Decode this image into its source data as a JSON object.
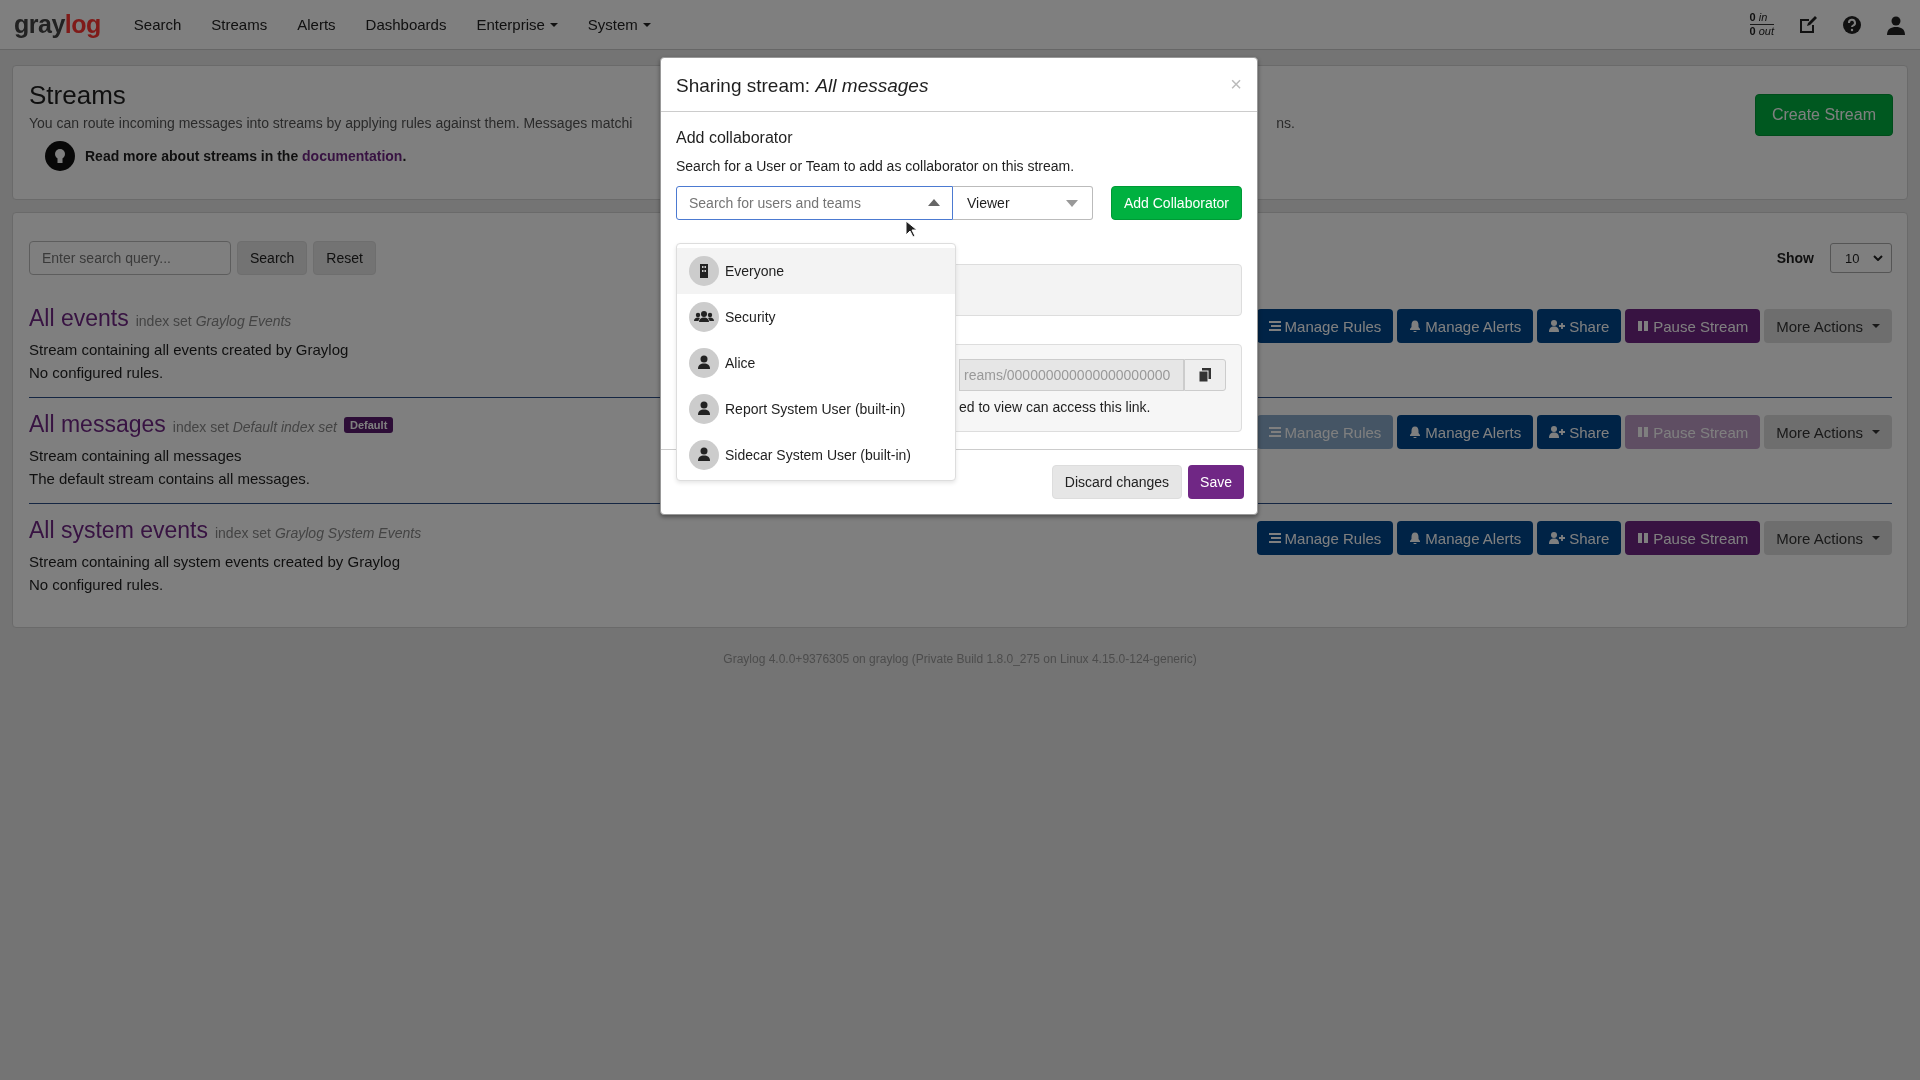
{
  "nav": {
    "logo": [
      "gray",
      "log"
    ],
    "items": [
      {
        "label": "Search",
        "dropdown": false
      },
      {
        "label": "Streams",
        "dropdown": false
      },
      {
        "label": "Alerts",
        "dropdown": false
      },
      {
        "label": "Dashboards",
        "dropdown": false
      },
      {
        "label": "Enterprise",
        "dropdown": true
      },
      {
        "label": "System",
        "dropdown": true
      }
    ],
    "throughput": [
      {
        "count": "0",
        "label": "in"
      },
      {
        "count": "0",
        "label": "out"
      }
    ]
  },
  "header": {
    "title": "Streams",
    "description": "You can route incoming messages into streams by applying rules against them. Messages matchi",
    "description_tail": "ns.",
    "tip": "Read more about streams in the ",
    "tip_link": "documentation",
    "tip_end": ".",
    "create_button": "Create Stream"
  },
  "list": {
    "search_placeholder": "Enter search query...",
    "search_button": "Search",
    "reset_button": "Reset",
    "show_label": "Show",
    "page_size": "10",
    "streams": [
      {
        "title": "All events",
        "index_label": "index set",
        "index_set": "Graylog Events",
        "lines": [
          "Stream containing all events created by Graylog",
          "No configured rules."
        ],
        "buttons": [
          {
            "kind": "rules",
            "label": "Manage Rules",
            "disabled": false
          },
          {
            "kind": "alerts",
            "label": "Manage Alerts",
            "disabled": false
          },
          {
            "kind": "share",
            "label": "Share",
            "disabled": false
          },
          {
            "kind": "pause",
            "label": "Pause Stream",
            "disabled": false
          },
          {
            "kind": "more",
            "label": "More Actions",
            "disabled": false
          }
        ]
      },
      {
        "title": "All messages",
        "index_label": "index set",
        "index_set": "Default index set",
        "badge": "Default",
        "lines": [
          "Stream containing all messages",
          "The default stream contains all messages."
        ],
        "buttons": [
          {
            "kind": "rules",
            "label": "Manage Rules",
            "disabled": true
          },
          {
            "kind": "alerts",
            "label": "Manage Alerts",
            "disabled": false
          },
          {
            "kind": "share",
            "label": "Share",
            "disabled": false
          },
          {
            "kind": "pause",
            "label": "Pause Stream",
            "disabled": true
          },
          {
            "kind": "more",
            "label": "More Actions",
            "disabled": false
          }
        ]
      },
      {
        "title": "All system events",
        "index_label": "index set",
        "index_set": "Graylog System Events",
        "lines": [
          "Stream containing all system events created by Graylog",
          "No configured rules."
        ],
        "buttons": [
          {
            "kind": "rules",
            "label": "Manage Rules",
            "disabled": false
          },
          {
            "kind": "alerts",
            "label": "Manage Alerts",
            "disabled": false
          },
          {
            "kind": "share",
            "label": "Share",
            "disabled": false
          },
          {
            "kind": "pause",
            "label": "Pause Stream",
            "disabled": false
          },
          {
            "kind": "more",
            "label": "More Actions",
            "disabled": false
          }
        ]
      }
    ]
  },
  "footer": "Graylog 4.0.0+9376305 on graylog (Private Build 1.8.0_275 on Linux 4.15.0-124-generic)",
  "modal": {
    "title": "Sharing stream: *All messages*",
    "close": "×",
    "section_title": "Add collaborator",
    "section_text": "Search for a User or Team to add as collaborator on this stream.",
    "search_placeholder": "Search for users and teams",
    "role": "Viewer",
    "add_button": "Add Collaborator",
    "options": [
      {
        "kind": "organization",
        "label": "Everyone",
        "selected": true
      },
      {
        "kind": "team",
        "label": "Security",
        "selected": false
      },
      {
        "kind": "user",
        "label": "Alice",
        "selected": false
      },
      {
        "kind": "user",
        "label": "Report System User (built-in)",
        "selected": false
      },
      {
        "kind": "user",
        "label": "Sidecar System User (built-in)",
        "selected": false
      }
    ],
    "link_value": "reams/000000000000000000000",
    "link_note": "ed to view can access this link.",
    "discard_button": "Discard changes",
    "save_button": "Save"
  }
}
